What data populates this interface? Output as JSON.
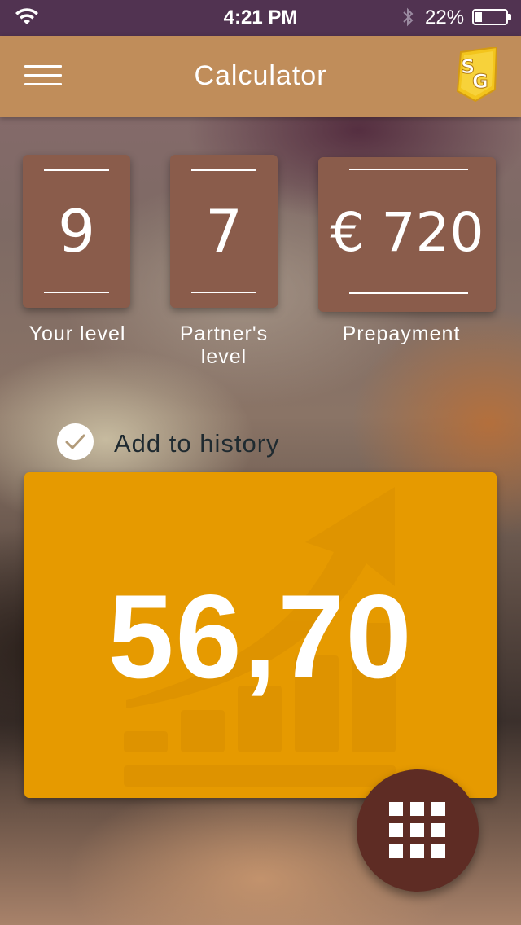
{
  "status_bar": {
    "time": "4:21 PM",
    "battery_percent": "22%",
    "battery_level": 0.22,
    "wifi_icon": "wifi-icon",
    "bluetooth_icon": "bluetooth-icon"
  },
  "app_bar": {
    "title": "Calculator",
    "menu_icon": "hamburger-menu-icon",
    "logo_text": "SG"
  },
  "inputs": {
    "your_level": {
      "value": "9",
      "label": "Your level"
    },
    "partner_level": {
      "value": "7",
      "label": "Partner's level"
    },
    "prepayment": {
      "value": "€ 720",
      "label": "Prepayment"
    }
  },
  "history": {
    "checked": true,
    "label": "Add to history"
  },
  "result": {
    "value": "56,70"
  },
  "fab": {
    "icon": "keypad-grid-icon"
  },
  "colors": {
    "status_bar": "#513351",
    "app_bar": "#c08d5a",
    "card": "#8a5c4b",
    "result_panel": "#e69a00",
    "fab": "#5e2c24"
  }
}
